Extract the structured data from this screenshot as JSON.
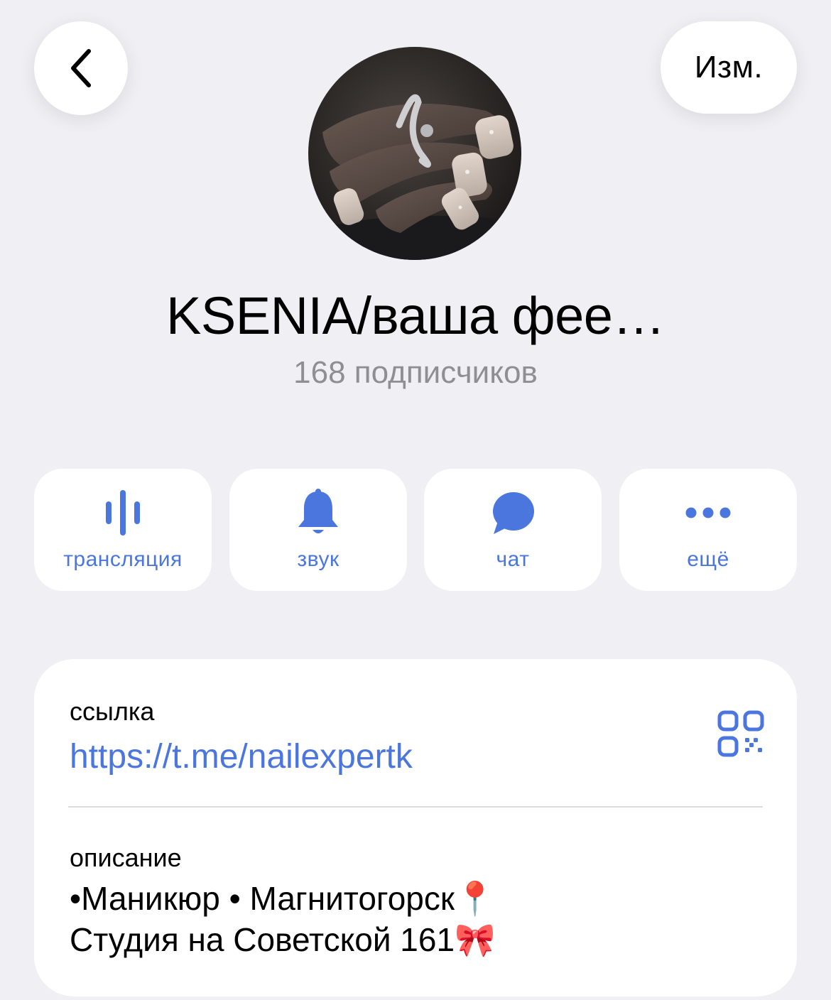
{
  "header": {
    "back_icon": "chevron-left-icon",
    "edit_label": "Изм."
  },
  "profile": {
    "name": "KSENIA/ваша фее…",
    "subscribers": "168 подписчиков",
    "avatar_description": "photo-of-manicured-hand-with-silver-ring"
  },
  "actions": [
    {
      "label": "трансляция",
      "icon": "live-stream-icon"
    },
    {
      "label": "звук",
      "icon": "bell-icon"
    },
    {
      "label": "чат",
      "icon": "chat-bubble-icon"
    },
    {
      "label": "ещё",
      "icon": "more-dots-icon"
    }
  ],
  "info": {
    "link_label": "ссылка",
    "link_value": "https://t.me/nailexpertk",
    "qr_icon": "qr-code-icon",
    "description_label": "описание",
    "description_lines": [
      "•Маникюр • Магнитогорск📍",
      "Студия на Советской 161🎀"
    ]
  },
  "colors": {
    "accent": "#4a76de",
    "background": "#efeff4",
    "card": "#ffffff",
    "secondary_text": "#8e8e93"
  }
}
